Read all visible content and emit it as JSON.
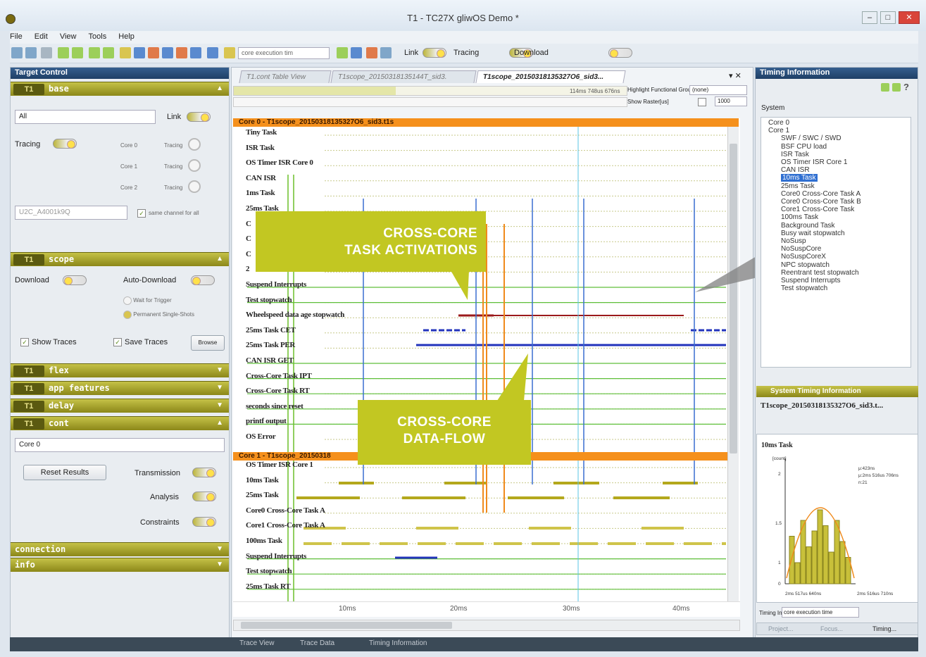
{
  "window": {
    "title": "T1 - TC27X gliwOS Demo *"
  },
  "menu": [
    "File",
    "Edit",
    "View",
    "Tools",
    "Help"
  ],
  "toolbar": {
    "measure_select": "core execution tim",
    "link_label": "Link",
    "tracing_label": "Tracing",
    "download_label": "Download"
  },
  "left": {
    "panel_title": "Target Control",
    "base": {
      "badge": "T1",
      "title": "base",
      "target_select": "All",
      "link_label": "Link",
      "tracing_label": "Tracing",
      "cores": [
        {
          "name": "Core 0",
          "tracing": "Tracing"
        },
        {
          "name": "Core 1",
          "tracing": "Tracing"
        },
        {
          "name": "Core 2",
          "tracing": "Tracing"
        }
      ],
      "channel_select": "U2C_A4001k9Q",
      "same_channel": "same channel for all"
    },
    "scope": {
      "badge": "T1",
      "title": "scope",
      "download_label": "Download",
      "auto_download_label": "Auto-Download",
      "wait_trigger": "Wait for Trigger",
      "permanent": "Permanent Single-Shots",
      "show_traces": "Show Traces",
      "save_traces": "Save Traces",
      "browse": "Browse"
    },
    "sections": [
      {
        "badge": "T1",
        "title": "flex"
      },
      {
        "badge": "T1",
        "title": "app features"
      },
      {
        "badge": "T1",
        "title": "delay"
      },
      {
        "badge": "T1",
        "title": "cont"
      }
    ],
    "cont": {
      "core_select": "Core 0",
      "reset": "Reset Results",
      "transmission": "Transmission",
      "analysis": "Analysis",
      "constraints": "Constraints"
    },
    "connection": "connection",
    "info": "info"
  },
  "center": {
    "tabs": [
      "T1.cont Table View",
      "T1scope_20150318135144T_sid3.",
      "T1scope_20150318135327O6_sid3..."
    ],
    "time_readout": "114ms 748us 676ns",
    "highlight_label": "Highlight Functional Group",
    "highlight_value": "(none)",
    "raster_label": "Show Raster[us]",
    "raster_value": "1000",
    "core0_title": "Core 0 - T1scope_20150318135327O6_sid3.t1s",
    "core0_traces": [
      "Tiny Task",
      "ISR Task",
      "OS Timer ISR Core 0",
      "CAN ISR",
      "1ms Task",
      "25ms Task",
      "C",
      "C",
      "C",
      "2",
      "Suspend Interrupts",
      "Test stopwatch",
      "Wheelspeed data age stopwatch",
      "25ms Task CET",
      "25ms Task PER",
      "CAN ISR GET",
      "Cross-Core Task IPT",
      "Cross-Core Task RT",
      "seconds since reset",
      "printf output",
      "OS Error"
    ],
    "core1_title": "Core 1 - T1scope_20150318",
    "core1_traces": [
      "OS Timer ISR Core 1",
      "10ms Task",
      "25ms Task",
      "Core0 Cross-Core Task A",
      "Core1 Cross-Core Task A",
      "100ms Task",
      "Suspend Interrupts",
      "Test stopwatch",
      "25ms Task RT"
    ],
    "time_ticks": [
      "10ms",
      "20ms",
      "30ms",
      "40ms"
    ],
    "callout1": [
      "CROSS-CORE",
      "TASK ACTIVATIONS"
    ],
    "callout2": [
      "CROSS-CORE",
      "DATA-FLOW"
    ],
    "bottom_tabs": [
      "Trace View",
      "Trace Data",
      "Timing Information"
    ]
  },
  "right": {
    "panel_title": "Timing Information",
    "system_label": "System",
    "tree": [
      "Core 0",
      "Core 1",
      "SWF / SWC / SWD",
      "BSF CPU load",
      "ISR Task",
      "OS Timer ISR Core 1",
      "CAN ISR",
      "10ms Task",
      "25ms Task",
      "Core0 Cross-Core Task A",
      "Core0 Cross-Core Task B",
      "Core1 Cross-Core Task",
      "100ms Task",
      "Background Task",
      "Busy wait stopwatch",
      "NoSusp",
      "NoSuspCore",
      "NoSuspCoreX",
      "NPC stopwatch",
      "Reentrant test stopwatch",
      "Suspend Interrupts",
      "Test stopwatch"
    ],
    "sys_timing_title": "System Timing Information",
    "trace_file": "T1scope_20150318135327O6_sid3.t...",
    "histogram_title": "10ms Task",
    "y_label": "[count]",
    "y_ticks": [
      "2",
      "1.5",
      "1",
      "0"
    ],
    "stats": [
      "μ:423ns",
      "μ:2ms 516us 706ns",
      "n:21"
    ],
    "x_ticks": [
      "2ms 517us 640ns",
      "2ms 516us 710ns"
    ],
    "timing_info_label": "Timing Info:",
    "timing_info_value": "core execution time",
    "bottom_tabs": [
      "Project...",
      "Focus...",
      "Timing..."
    ]
  }
}
